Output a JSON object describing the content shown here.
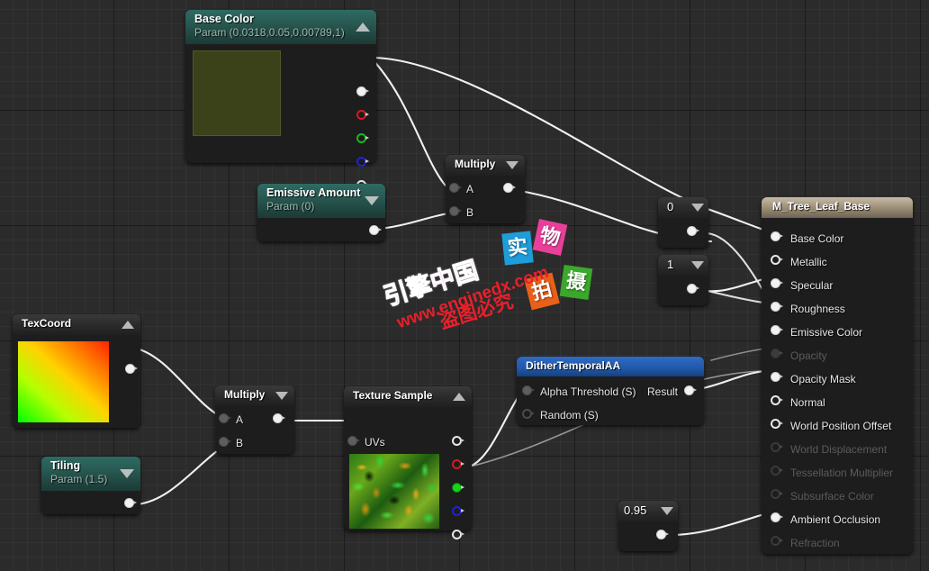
{
  "editor": {
    "name": "material-graph-editor",
    "background_color": "#2b2b2b",
    "wire_color": "#f0f0f0"
  },
  "nodes": {
    "base_color": {
      "title": "Base Color",
      "subtitle": "Param (0.0318,0.05,0.00789,1)",
      "swatch_color": "#3b4119",
      "collapse_icon": "chevron-up-icon",
      "outputs": [
        {
          "label": "",
          "color": "#ffffff",
          "state": "connected"
        },
        {
          "label": "",
          "color": "#d21c22",
          "state": "unconnected"
        },
        {
          "label": "",
          "color": "#16b81a",
          "state": "unconnected"
        },
        {
          "label": "",
          "color": "#2023cf",
          "state": "unconnected"
        },
        {
          "label": "",
          "color": "#ffffff",
          "state": "unconnected"
        }
      ]
    },
    "emissive_amount": {
      "title": "Emissive Amount",
      "subtitle": "Param (0)",
      "collapse_icon": "chevron-down-icon",
      "outputs": [
        {
          "label": "",
          "color": "#ffffff",
          "state": "connected"
        }
      ]
    },
    "multiply_top": {
      "title": "Multiply",
      "collapse_icon": "chevron-down-icon",
      "inputs": [
        {
          "label": "A"
        },
        {
          "label": "B"
        }
      ],
      "outputs": [
        {
          "label": "",
          "state": "connected"
        }
      ]
    },
    "multiply_bottom": {
      "title": "Multiply",
      "collapse_icon": "chevron-down-icon",
      "inputs": [
        {
          "label": "A"
        },
        {
          "label": "B"
        }
      ],
      "outputs": [
        {
          "label": "",
          "state": "connected"
        }
      ]
    },
    "texcoord": {
      "title": "TexCoord",
      "collapse_icon": "chevron-up-icon",
      "outputs": [
        {
          "label": "",
          "state": "connected"
        }
      ]
    },
    "tiling": {
      "title": "Tiling",
      "subtitle": "Param (1.5)",
      "collapse_icon": "chevron-down-icon",
      "outputs": [
        {
          "label": "",
          "state": "connected"
        }
      ]
    },
    "texture_sample": {
      "title": "Texture Sample",
      "collapse_icon": "chevron-up-icon",
      "inputs": [
        {
          "label": "UVs"
        }
      ],
      "outputs": [
        {
          "label": "",
          "color": "#ffffff",
          "state": "unconnected"
        },
        {
          "label": "",
          "color": "#d21c22",
          "state": "unconnected"
        },
        {
          "label": "",
          "color": "#16b81a",
          "state": "connected"
        },
        {
          "label": "",
          "color": "#2023cf",
          "state": "unconnected"
        },
        {
          "label": "",
          "color": "#ffffff",
          "state": "unconnected"
        }
      ]
    },
    "dither": {
      "title": "DitherTemporalAA",
      "inputs": [
        {
          "label": "Alpha Threshold (S)",
          "state": "connected"
        },
        {
          "label": "Random (S)",
          "state": "unconnected"
        }
      ],
      "outputs": [
        {
          "label": "Result",
          "state": "connected"
        }
      ]
    },
    "const_0": {
      "value": "0",
      "collapse_icon": "chevron-down-icon"
    },
    "const_1": {
      "value": "1",
      "collapse_icon": "chevron-down-icon"
    },
    "const_095": {
      "value": "0.95",
      "collapse_icon": "chevron-down-icon"
    },
    "material_output": {
      "title": "M_Tree_Leaf_Base",
      "pins": [
        {
          "label": "Base Color",
          "state": "connected",
          "enabled": true
        },
        {
          "label": "Metallic",
          "state": "unconnected",
          "enabled": true
        },
        {
          "label": "Specular",
          "state": "connected",
          "enabled": true
        },
        {
          "label": "Roughness",
          "state": "connected",
          "enabled": true
        },
        {
          "label": "Emissive Color",
          "state": "connected",
          "enabled": true
        },
        {
          "label": "Opacity",
          "state": "connected",
          "enabled": false
        },
        {
          "label": "Opacity Mask",
          "state": "connected",
          "enabled": true
        },
        {
          "label": "Normal",
          "state": "unconnected",
          "enabled": true
        },
        {
          "label": "World Position Offset",
          "state": "unconnected",
          "enabled": true
        },
        {
          "label": "World Displacement",
          "state": "unconnected",
          "enabled": false
        },
        {
          "label": "Tessellation Multiplier",
          "state": "unconnected",
          "enabled": false
        },
        {
          "label": "Subsurface Color",
          "state": "unconnected",
          "enabled": false
        },
        {
          "label": "Ambient Occlusion",
          "state": "connected",
          "enabled": true
        },
        {
          "label": "Refraction",
          "state": "unconnected",
          "enabled": false
        }
      ]
    }
  },
  "watermark": {
    "brand": "引擎中国",
    "url": "www.enginedx.com",
    "warning": "盗图必究",
    "tiles": [
      {
        "char": "实",
        "color": "#1f9dd8"
      },
      {
        "char": "物",
        "color": "#e8409a"
      },
      {
        "char": "拍",
        "color": "#e8601a"
      },
      {
        "char": "摄",
        "color": "#3aa82a"
      }
    ]
  }
}
